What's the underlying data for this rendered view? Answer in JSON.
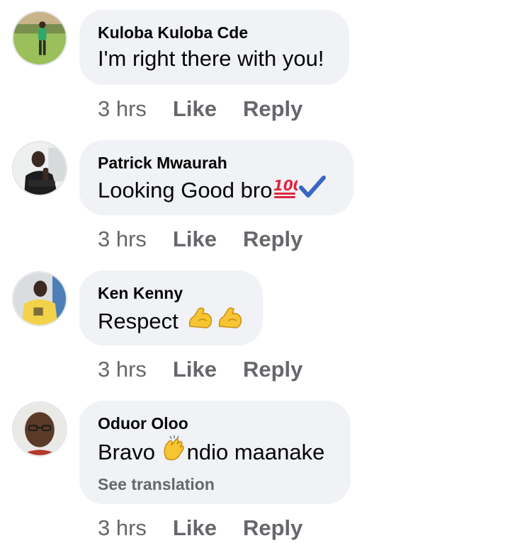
{
  "comments": [
    {
      "author": "Kuloba Kuloba Cde",
      "text_parts": [
        "I'm right there with you!"
      ],
      "time": "3 hrs",
      "like_label": "Like",
      "reply_label": "Reply"
    },
    {
      "author": "Patrick Mwaurah",
      "text_parts": [
        "Looking Good bro"
      ],
      "emojis": [
        "hundred-points-emoji",
        "check-mark-emoji"
      ],
      "time": "3 hrs",
      "like_label": "Like",
      "reply_label": "Reply"
    },
    {
      "author": "Ken Kenny",
      "text_parts": [
        "Respect "
      ],
      "emojis": [
        "flexed-biceps-emoji",
        "flexed-biceps-emoji"
      ],
      "time": "3 hrs",
      "like_label": "Like",
      "reply_label": "Reply"
    },
    {
      "author": "Oduor Oloo",
      "text_parts": [
        "Bravo ",
        "ndio maanake"
      ],
      "emojis": [
        "clapping-hands-emoji"
      ],
      "see_translation": "See translation",
      "time": "3 hrs",
      "like_label": "Like",
      "reply_label": "Reply"
    }
  ],
  "colors": {
    "bubble": "#f0f2f5",
    "text": "#050505",
    "meta": "#65676b",
    "check": "#3b66c4",
    "hundred": "#e2233c",
    "emoji_yellow": "#f7c531"
  }
}
